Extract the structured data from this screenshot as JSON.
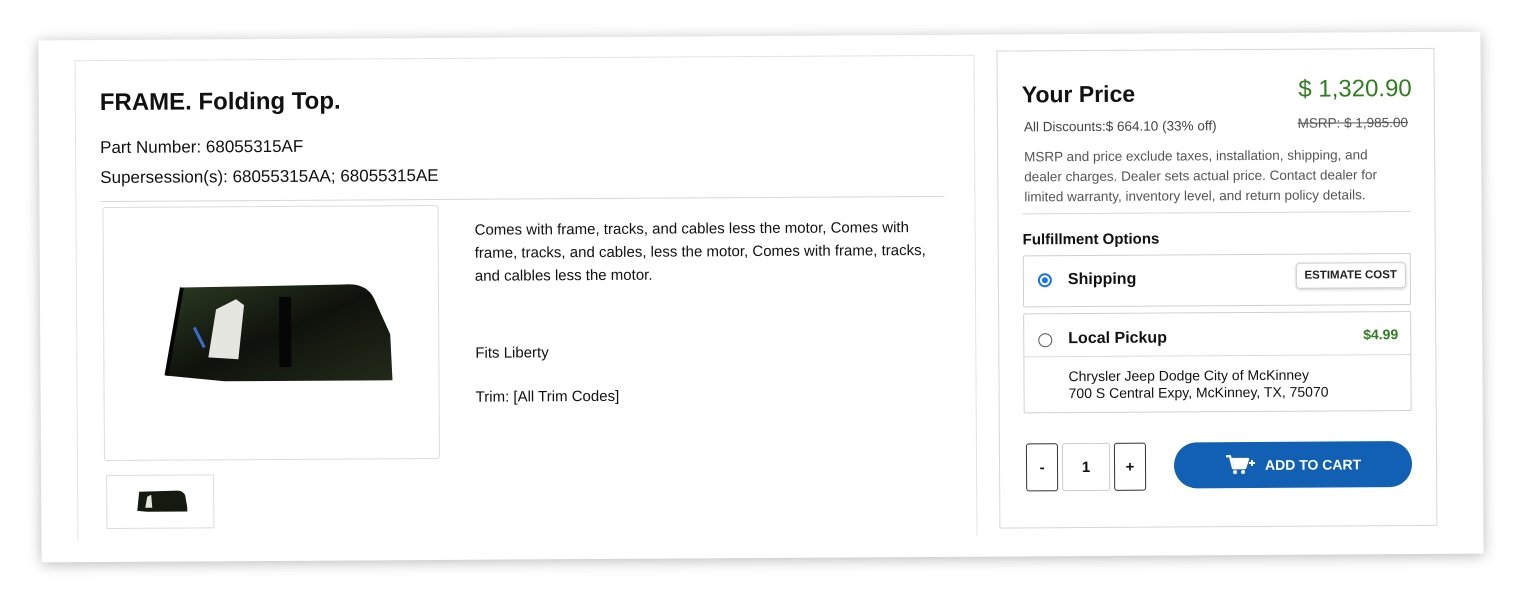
{
  "product": {
    "title": "FRAME. Folding Top.",
    "part_number": "Part Number: 68055315AF",
    "supersession_label": "Supersession(s): ",
    "supersession_values": "68055315AA; 68055315AE",
    "description": "Comes with frame, tracks, and cables less the motor, Comes with frame, tracks, and cables, less the motor, Comes with frame, tracks, and calbles less the motor.",
    "fits": "Fits Liberty",
    "trim": "Trim: [All Trim Codes]"
  },
  "pricing": {
    "your_price_label": "Your Price",
    "price": "$ 1,320.90",
    "discounts": "All Discounts:$ 664.10 (33% off)",
    "msrp": "MSRP: $ 1,985.00",
    "disclaimer": "MSRP and price exclude taxes, installation, shipping, and dealer charges. Dealer sets actual price. Contact dealer for limited warranty, inventory level, and return policy details."
  },
  "fulfillment": {
    "heading": "Fulfillment Options",
    "shipping_label": "Shipping",
    "estimate_button": "ESTIMATE COST",
    "pickup_label": "Local Pickup",
    "pickup_fee": "$4.99",
    "dealer_name": "Chrysler Jeep Dodge City of McKinney",
    "dealer_address": "700 S Central Expy, McKinney, TX, 75070",
    "selected": "Shipping"
  },
  "cart": {
    "minus": "-",
    "quantity": "1",
    "plus": "+",
    "add_label": "ADD TO CART"
  },
  "icons": {
    "cart": "cart-plus-icon"
  },
  "colors": {
    "price_green": "#2e7d1e",
    "cart_blue": "#1160b4",
    "radio_blue": "#1a73e8"
  }
}
